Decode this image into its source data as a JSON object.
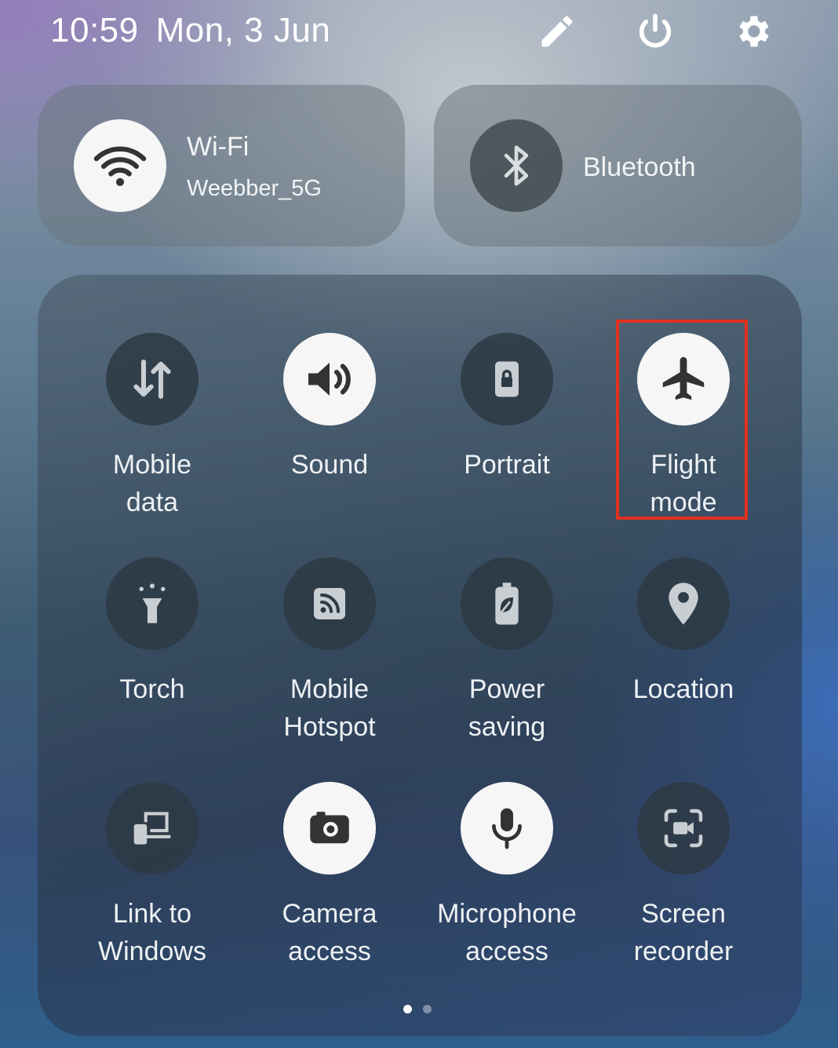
{
  "status_bar": {
    "time": "10:59",
    "date": "Mon, 3 Jun",
    "icons": [
      "edit-icon",
      "power-icon",
      "settings-gear-icon"
    ]
  },
  "wifi": {
    "title": "Wi-Fi",
    "network": "Weebber_5G",
    "state": "on",
    "icon": "wifi-icon"
  },
  "bluetooth": {
    "title": "Bluetooth",
    "state": "off",
    "icon": "bluetooth-icon"
  },
  "tiles": [
    {
      "line1": "Mobile",
      "line2": "data",
      "state": "off",
      "icon": "mobile-data-arrows-icon"
    },
    {
      "line1": "Sound",
      "line2": "",
      "state": "on",
      "icon": "speaker-icon"
    },
    {
      "line1": "Portrait",
      "line2": "",
      "state": "off",
      "icon": "portrait-lock-icon"
    },
    {
      "line1": "Flight",
      "line2": "mode",
      "state": "on",
      "icon": "airplane-icon",
      "highlighted": true
    },
    {
      "line1": "Torch",
      "line2": "",
      "state": "off",
      "icon": "flashlight-icon"
    },
    {
      "line1": "Mobile",
      "line2": "Hotspot",
      "state": "off",
      "icon": "hotspot-icon"
    },
    {
      "line1": "Power",
      "line2": "saving",
      "state": "off",
      "icon": "battery-leaf-icon"
    },
    {
      "line1": "Location",
      "line2": "",
      "state": "off",
      "icon": "location-pin-icon"
    },
    {
      "line1": "Link to",
      "line2": "Windows",
      "state": "off",
      "icon": "link-to-windows-icon"
    },
    {
      "line1": "Camera",
      "line2": "access",
      "state": "on",
      "icon": "camera-icon"
    },
    {
      "line1": "Microphone",
      "line2": "access",
      "state": "on",
      "icon": "microphone-icon"
    },
    {
      "line1": "Screen",
      "line2": "recorder",
      "state": "off",
      "icon": "screen-recorder-icon"
    }
  ],
  "pager": {
    "pages": 2,
    "current": 1
  },
  "colors": {
    "highlight": "#e2311f",
    "tile_on": "#f6f6f6",
    "tile_off": "#2d3a44"
  }
}
